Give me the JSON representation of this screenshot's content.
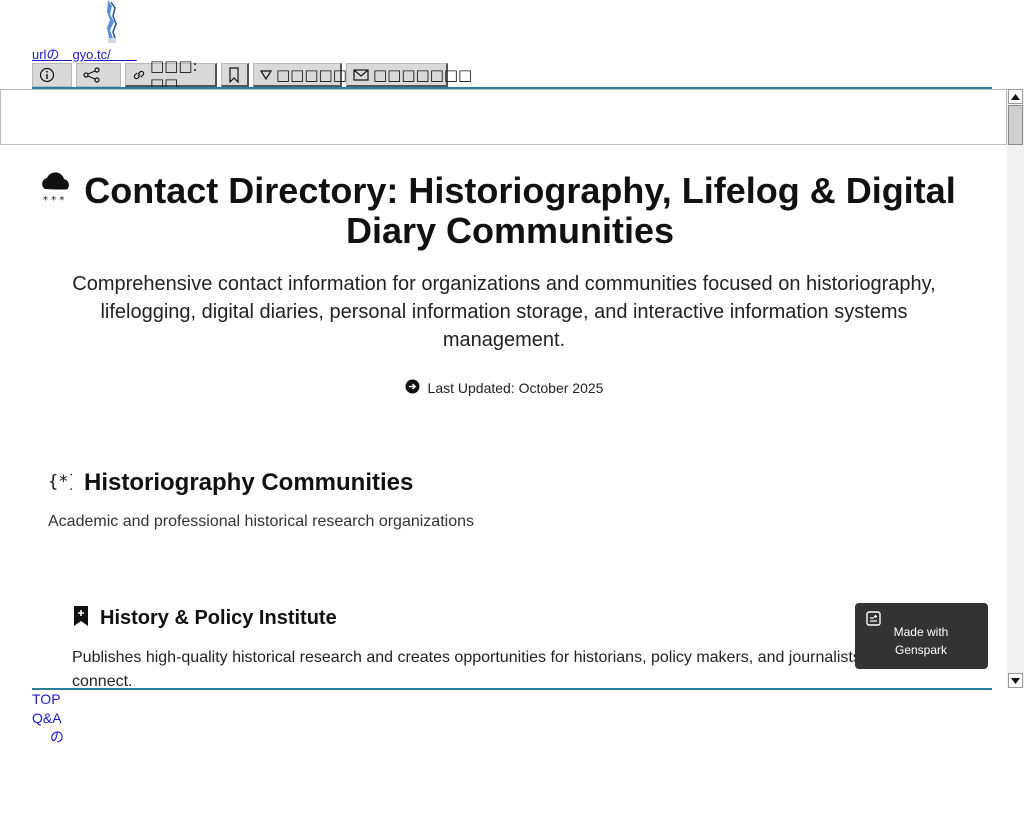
{
  "shortener": {
    "url_text": "urlの　gyo.tc/　　",
    "toolbar": [
      {
        "name": "info",
        "label": ""
      },
      {
        "name": "share",
        "label": ""
      },
      {
        "name": "link",
        "label": "□□□: □□"
      },
      {
        "name": "bookmark",
        "label": ""
      },
      {
        "name": "filter",
        "label": "□□□□□□"
      },
      {
        "name": "mail",
        "label": "□□□□□□□"
      }
    ],
    "footer_links": [
      "TOP",
      "Q&A",
      "の"
    ]
  },
  "page": {
    "title": "Contact Directory: Historiography, Lifelog & Digital Diary Communities",
    "intro": "Comprehensive contact information for organizations and communities focused on historiography, lifelogging, digital diaries, personal information storage, and interactive information systems management.",
    "last_updated": "Last Updated: October 2025",
    "section": {
      "title": "Historiography Communities",
      "subtitle": "Academic and professional historical research organizations"
    },
    "card": {
      "title": "History & Policy Institute",
      "description": "Publishes high-quality historical research and creates opportunities for historians, policy makers, and journalists to connect."
    },
    "badge": "Made with Genspark"
  },
  "colors": {
    "accent_rule": "#2b7e9e",
    "badge_bg": "#333333",
    "link": "#1a1acc"
  }
}
